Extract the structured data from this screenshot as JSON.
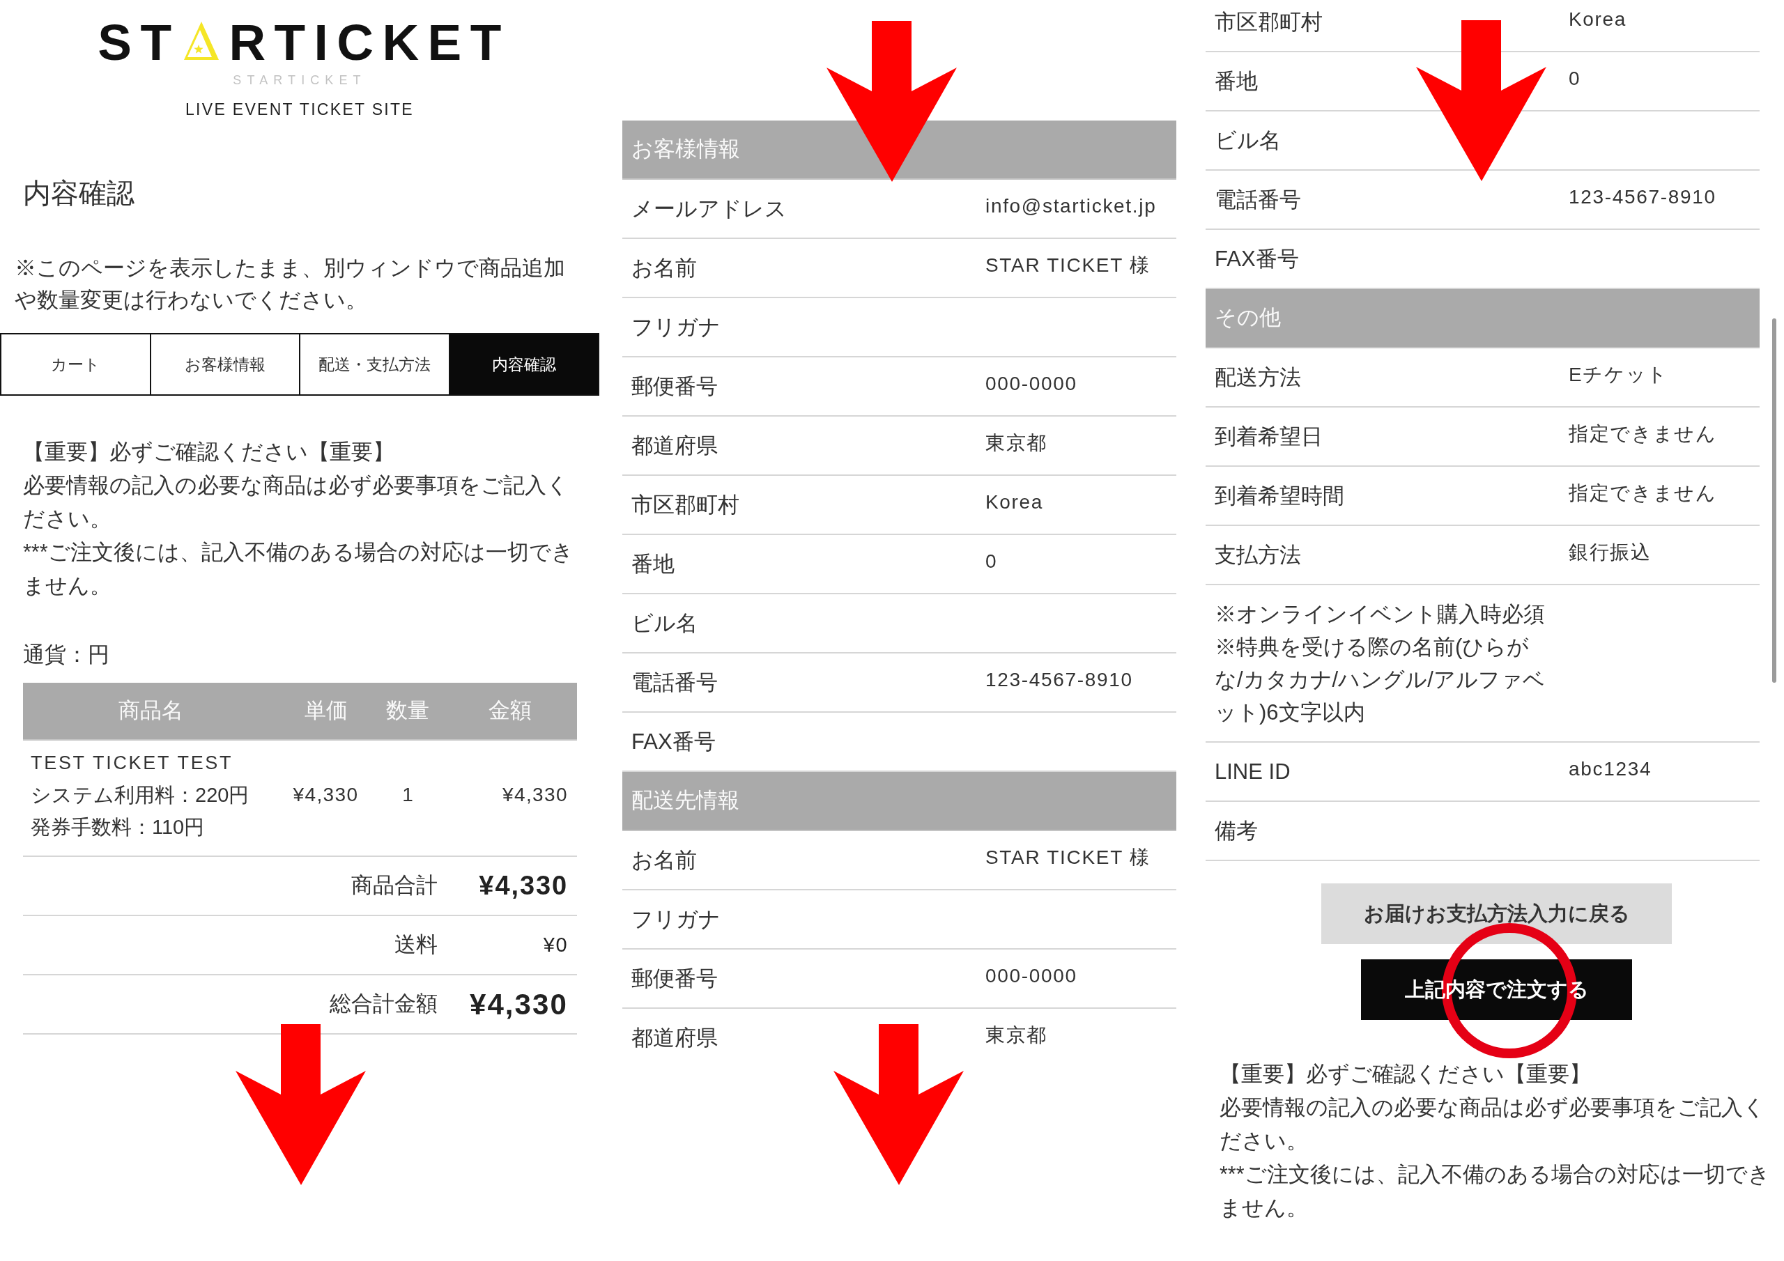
{
  "site_header": {
    "logo_left": "ST",
    "logo_right": "RTICKET",
    "logo_subtext": "STARTICKET",
    "tagline": "LIVE EVENT TICKET SITE"
  },
  "page_title": "内容確認",
  "warning": "※このページを表示したまま、別ウィンドウで商品追加や数量変更は行わないでください。",
  "steps": [
    {
      "label": "カート",
      "selected": false
    },
    {
      "label": "お客様情報",
      "selected": false
    },
    {
      "label": "配送・支払方法",
      "selected": false
    },
    {
      "label": "内容確認",
      "selected": true
    }
  ],
  "notice": [
    "【重要】必ずご確認ください【重要】",
    "必要情報の記入の必要な商品は必ず必要事項をご記入ください。",
    "***ご注文後には、記入不備のある場合の対応は一切できません。"
  ],
  "currency": "通貨：円",
  "cart": {
    "columns": [
      "商品名",
      "単価",
      "数量",
      "金額"
    ],
    "rows": [
      {
        "name": "TEST TICKET TEST",
        "fees": [
          "システム利用料：220円",
          "発券手数料：110円"
        ],
        "unit_price": "¥4,330",
        "quantity": "1",
        "amount": "¥4,330"
      }
    ],
    "totals": [
      {
        "label": "商品合計",
        "value": "¥4,330",
        "kind": "subtotal"
      },
      {
        "label": "送料",
        "value": "¥0",
        "kind": "shipping"
      },
      {
        "label": "総合計金額",
        "value": "¥4,330",
        "kind": "total"
      }
    ]
  },
  "screen_2": {
    "sections": [
      {
        "title": "お客様情報",
        "rows": [
          {
            "label": "メールアドレス",
            "value": "info@starticket.jp"
          },
          {
            "label": "お名前",
            "value": "STAR TICKET 様"
          },
          {
            "label": "フリガナ"
          },
          {
            "label": "郵便番号",
            "value": "000-0000"
          },
          {
            "label": "都道府県",
            "value": "東京都"
          },
          {
            "label": "市区郡町村",
            "value": "Korea"
          },
          {
            "label": "番地",
            "value": "0"
          },
          {
            "label": "ビル名"
          },
          {
            "label": "電話番号",
            "value": "123-4567-8910"
          },
          {
            "label": "FAX番号"
          }
        ]
      },
      {
        "title": "配送先情報",
        "rows": [
          {
            "label": "お名前",
            "value": "STAR TICKET 様"
          },
          {
            "label": "フリガナ"
          },
          {
            "label": "郵便番号",
            "value": "000-0000"
          },
          {
            "label": "都道府県",
            "value": "東京都"
          }
        ]
      }
    ]
  },
  "screen_3": {
    "sections": [
      {
        "rows": [
          {
            "label": "市区郡町村",
            "value": "Korea"
          },
          {
            "label": "番地",
            "value": "0"
          },
          {
            "label": "ビル名"
          },
          {
            "label": "電話番号",
            "value": "123-4567-8910"
          },
          {
            "label": "FAX番号"
          }
        ]
      },
      {
        "title": "その他",
        "rows": [
          {
            "label": "配送方法",
            "value": "Eチケット"
          },
          {
            "label": "到着希望日",
            "value": "指定できません"
          },
          {
            "label": "到着希望時間",
            "value": "指定できません"
          },
          {
            "label": "支払方法",
            "value": "銀行振込"
          },
          {
            "label": "※オンラインイベント購入時必須\n※特典を受ける際の名前(ひらがな/カタカナ/ハングル/アルファベット)6文字以内"
          },
          {
            "label": "LINE ID",
            "value": "abc1234"
          },
          {
            "label": "備考"
          }
        ]
      }
    ],
    "buttons": [
      {
        "label": "お届けお支払方法入力に戻る",
        "kind": "secondary"
      },
      {
        "label": "上記内容で注文する",
        "kind": "primary"
      }
    ],
    "notice": [
      "【重要】必ずご確認ください【重要】",
      "必要情報の記入の必要な商品は必ず必要事項をご記入ください。",
      "***ご注文後には、記入不備のある場合の対応は一切できません。"
    ]
  }
}
